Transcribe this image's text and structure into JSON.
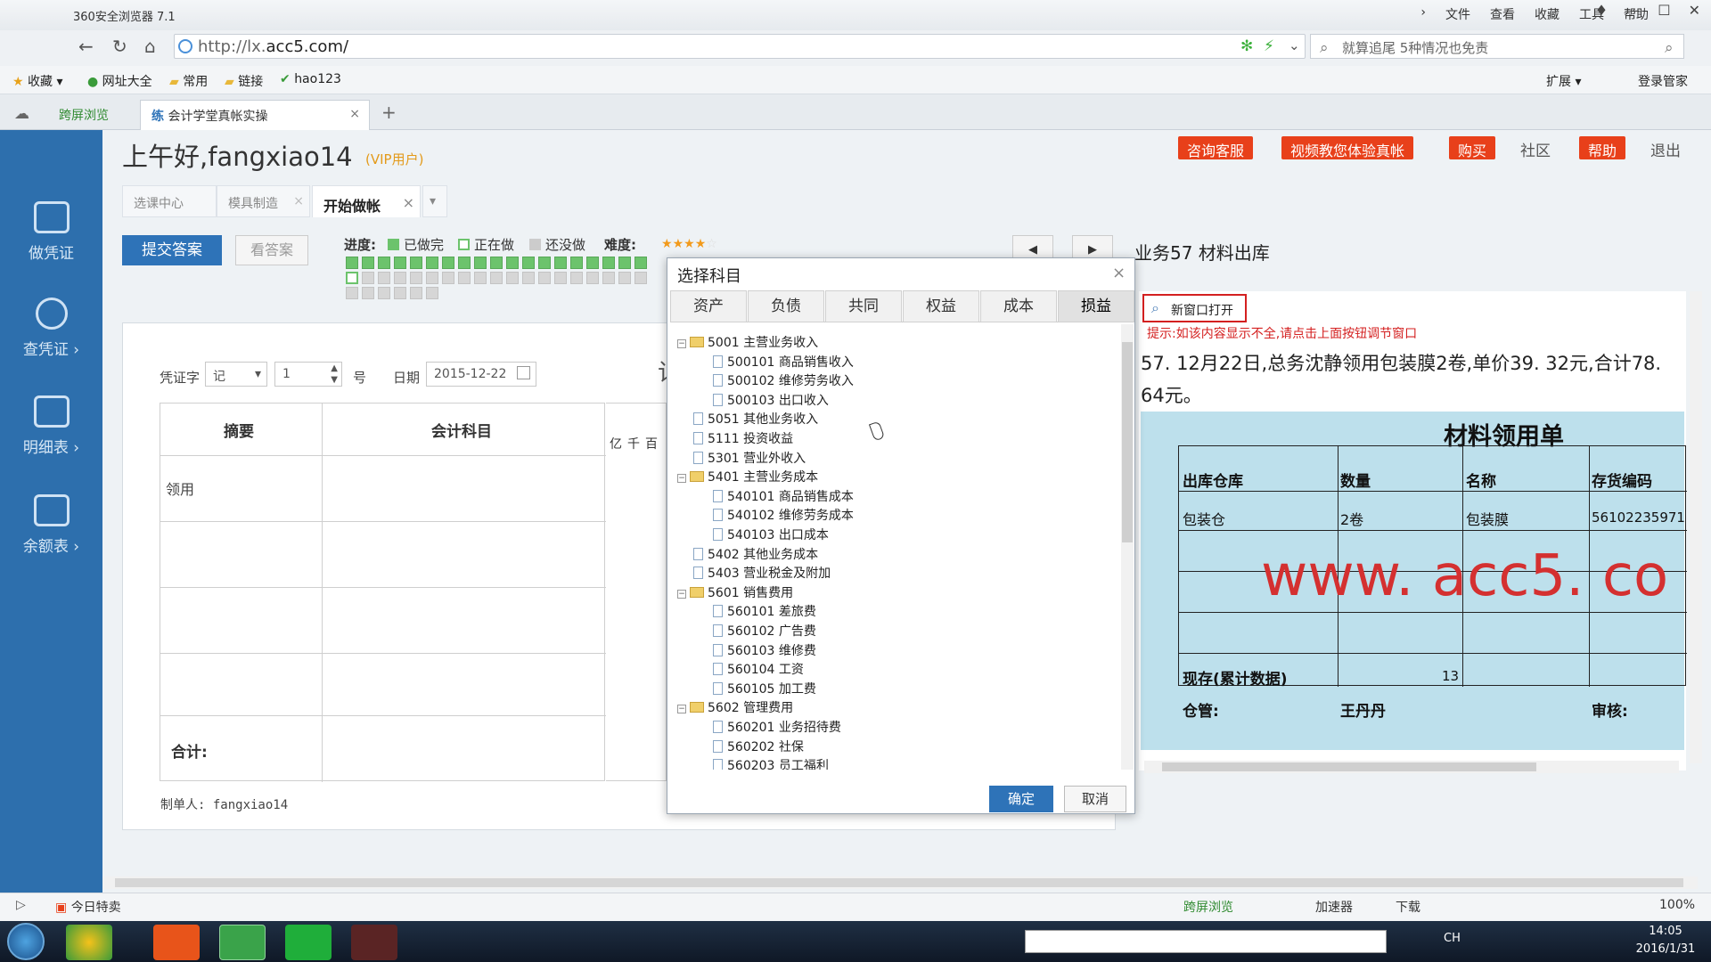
{
  "browser": {
    "title": "360安全浏览器 7.1",
    "logo": "NEW",
    "menu": [
      "文件",
      "查看",
      "收藏",
      "工具",
      "帮助"
    ],
    "url_prefix": "http://lx.",
    "url_domain": "acc5.com/",
    "search_placeholder": "就算追尾 5种情况也免责",
    "bookmarks": [
      "收藏",
      "网址大全",
      "常用",
      "链接",
      "hao123"
    ],
    "extend": "扩展",
    "login": "登录管家",
    "tabs": [
      "跨屏浏览",
      "会计学堂真帐实操"
    ],
    "tab_badge": "练"
  },
  "sidebar": {
    "items": [
      "做凭证",
      "查凭证 ›",
      "明细表 ›",
      "余额表 ›"
    ]
  },
  "header": {
    "greeting": "上午好,fangxiao14",
    "vip": "(VIP用户)",
    "buttons": [
      "咨询客服",
      "视频教您体验真帐",
      "购买",
      "帮助"
    ],
    "links": [
      "社区",
      "退出"
    ]
  },
  "subtabs": [
    "选课中心",
    "模具制造",
    "开始做帐"
  ],
  "toolbar": {
    "submit": "提交答案",
    "answer": "看答案",
    "progress_label": "进度:",
    "done": "已做完",
    "doing": "正在做",
    "notdone": "还没做",
    "difficulty_label": "难度:",
    "difficulty": 4
  },
  "progress": {
    "done": 19,
    "current": 1,
    "notdone": 24
  },
  "business_title": "业务57  材料出库",
  "voucher": {
    "word_label": "凭证字",
    "word": "记",
    "number": "1",
    "number_unit": "号",
    "date_label": "日期",
    "date": "2015-12-22",
    "col_summary": "摘要",
    "col_subject": "会计科目",
    "units": [
      "亿",
      "千",
      "百"
    ],
    "row1_summary": "领用",
    "total_label": "合计:",
    "maker": "制单人: fangxiao14",
    "title_char": "记"
  },
  "dialog": {
    "title": "选择科目",
    "tabs": [
      "资产",
      "负债",
      "共同",
      "权益",
      "成本",
      "损益"
    ],
    "active_tab": "损益",
    "tree": [
      {
        "level": 0,
        "text": "5001 主营业务收入",
        "folder": true
      },
      {
        "level": 1,
        "text": "500101 商品销售收入"
      },
      {
        "level": 1,
        "text": "500102 维修劳务收入"
      },
      {
        "level": 1,
        "text": "500103 出口收入"
      },
      {
        "level": 0,
        "text": "5051 其他业务收入"
      },
      {
        "level": 0,
        "text": "5111 投资收益"
      },
      {
        "level": 0,
        "text": "5301 营业外收入"
      },
      {
        "level": 0,
        "text": "5401 主营业务成本",
        "folder": true
      },
      {
        "level": 1,
        "text": "540101 商品销售成本"
      },
      {
        "level": 1,
        "text": "540102 维修劳务成本"
      },
      {
        "level": 1,
        "text": "540103 出口成本"
      },
      {
        "level": 0,
        "text": "5402 其他业务成本"
      },
      {
        "level": 0,
        "text": "5403 营业税金及附加"
      },
      {
        "level": 0,
        "text": "5601 销售费用",
        "folder": true
      },
      {
        "level": 1,
        "text": "560101 差旅费"
      },
      {
        "level": 1,
        "text": "560102 广告费"
      },
      {
        "level": 1,
        "text": "560103 维修费"
      },
      {
        "level": 1,
        "text": "560104 工资"
      },
      {
        "level": 1,
        "text": "560105 加工费"
      },
      {
        "level": 0,
        "text": "5602 管理费用",
        "folder": true
      },
      {
        "level": 1,
        "text": "560201 业务招待费"
      },
      {
        "level": 1,
        "text": "560202 社保"
      },
      {
        "level": 1,
        "text": "560203 员工福利"
      }
    ],
    "ok": "确定",
    "cancel": "取消"
  },
  "rightpanel": {
    "open_window": "新窗口打开",
    "tip": "提示:如该内容显示不全,请点击上面按钮调节窗口",
    "description": "57. 12月22日,总务沈静领用包装膜2卷,单价39. 32元,合计78. 64元。",
    "form_title": "材料领用单",
    "headers": [
      "出库仓库",
      "数量",
      "名称",
      "存货编码"
    ],
    "row": [
      "包装仓",
      "2卷",
      "包装膜",
      "56102235971"
    ],
    "stock_label": "现存(累计数据)",
    "stock_value": "13",
    "keeper_label": "仓管:",
    "keeper": "王丹丹",
    "auditor_label": "审核:",
    "watermark": "www. acc5. co"
  },
  "statusbar": {
    "today": "今日特卖",
    "items": [
      "跨屏浏览",
      "加速器",
      "下载"
    ],
    "zoom": "100%"
  },
  "taskbar": {
    "time": "14:05",
    "date": "2016/1/31",
    "lang": "CH"
  }
}
